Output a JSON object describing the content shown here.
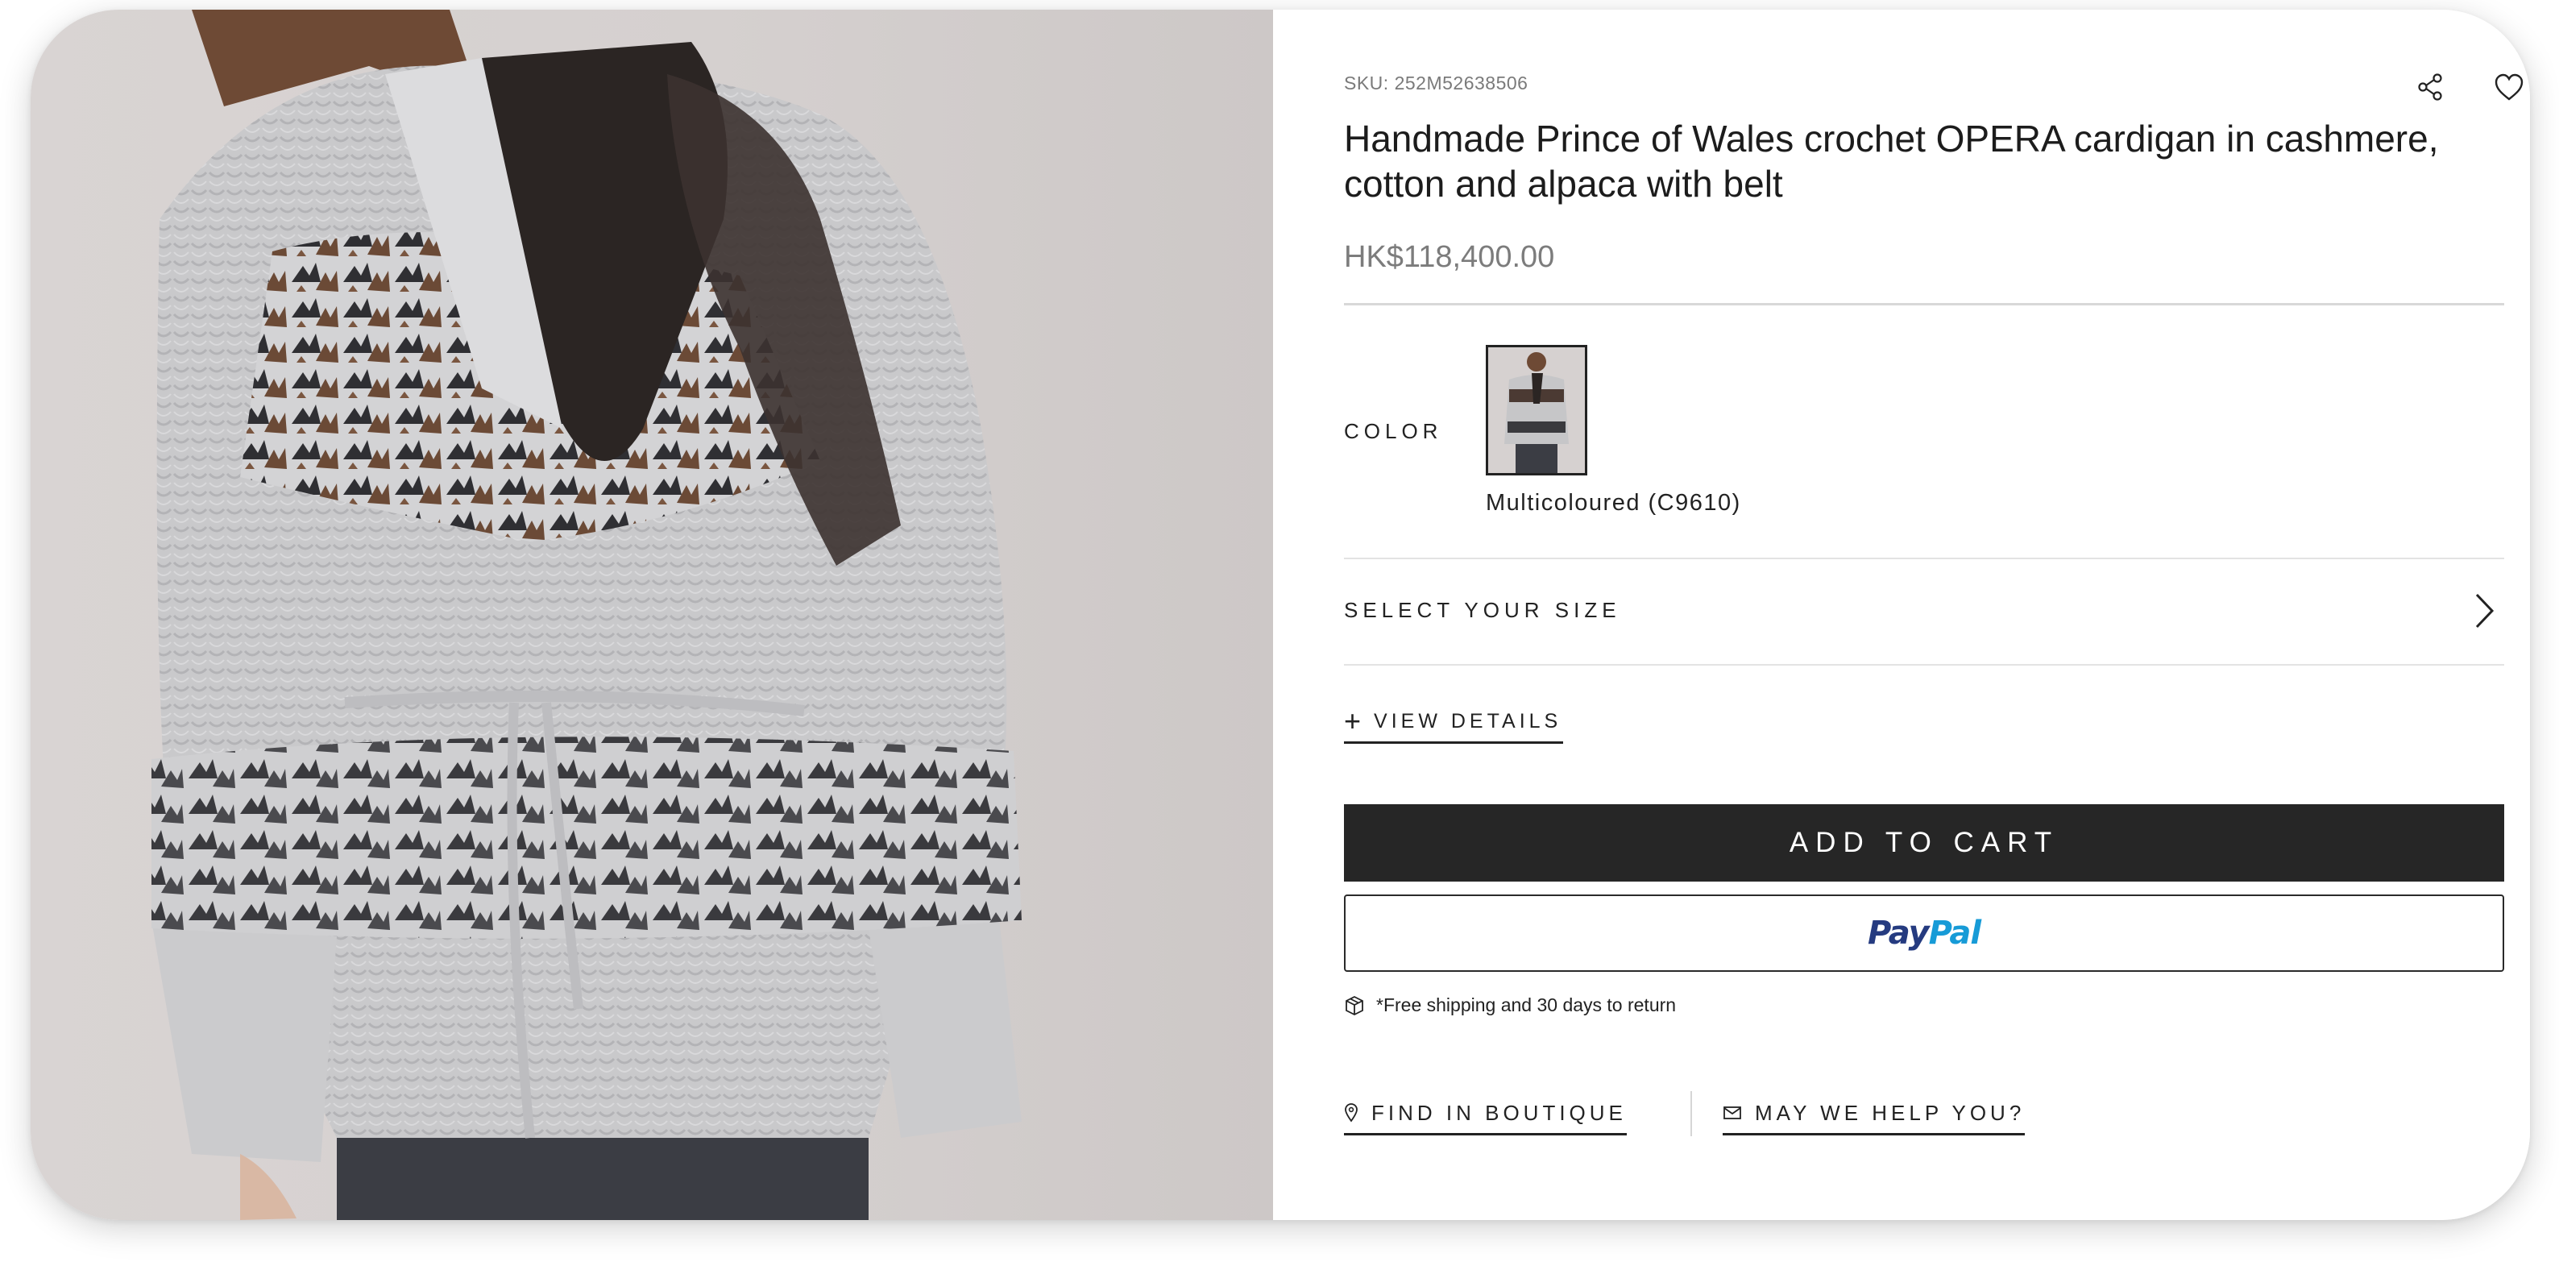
{
  "product": {
    "sku": "SKU: 252M52638506",
    "title": "Handmade Prince of Wales crochet OPERA cardigan in cashmere, cotton and alpaca with belt",
    "price": "HK$118,400.00",
    "image_alt": "Model wearing knit cardigan with belt and dark scarf"
  },
  "icons": {
    "share": "share-icon",
    "wishlist": "heart-icon",
    "size_chevron": "chevron-right-icon",
    "details_plus": "plus-icon",
    "shipping": "package-icon",
    "boutique": "location-pin-icon",
    "help": "mail-icon"
  },
  "color": {
    "label": "COLOR",
    "selected": "Multicoloured (C9610)"
  },
  "size": {
    "label": "SELECT YOUR SIZE"
  },
  "details": {
    "plus": "+",
    "label": "VIEW DETAILS"
  },
  "actions": {
    "add_to_cart": "ADD TO CART",
    "paypal_a": "Pay",
    "paypal_b": "Pal"
  },
  "shipping_note": "*Free shipping and 30 days to return",
  "links": {
    "boutique": "FIND IN BOUTIQUE",
    "help": "MAY WE HELP YOU?"
  },
  "colors": {
    "cart_button": "#262626",
    "paypal_dark": "#253b80",
    "paypal_light": "#179bd7",
    "price_text": "#7c7c7c"
  }
}
